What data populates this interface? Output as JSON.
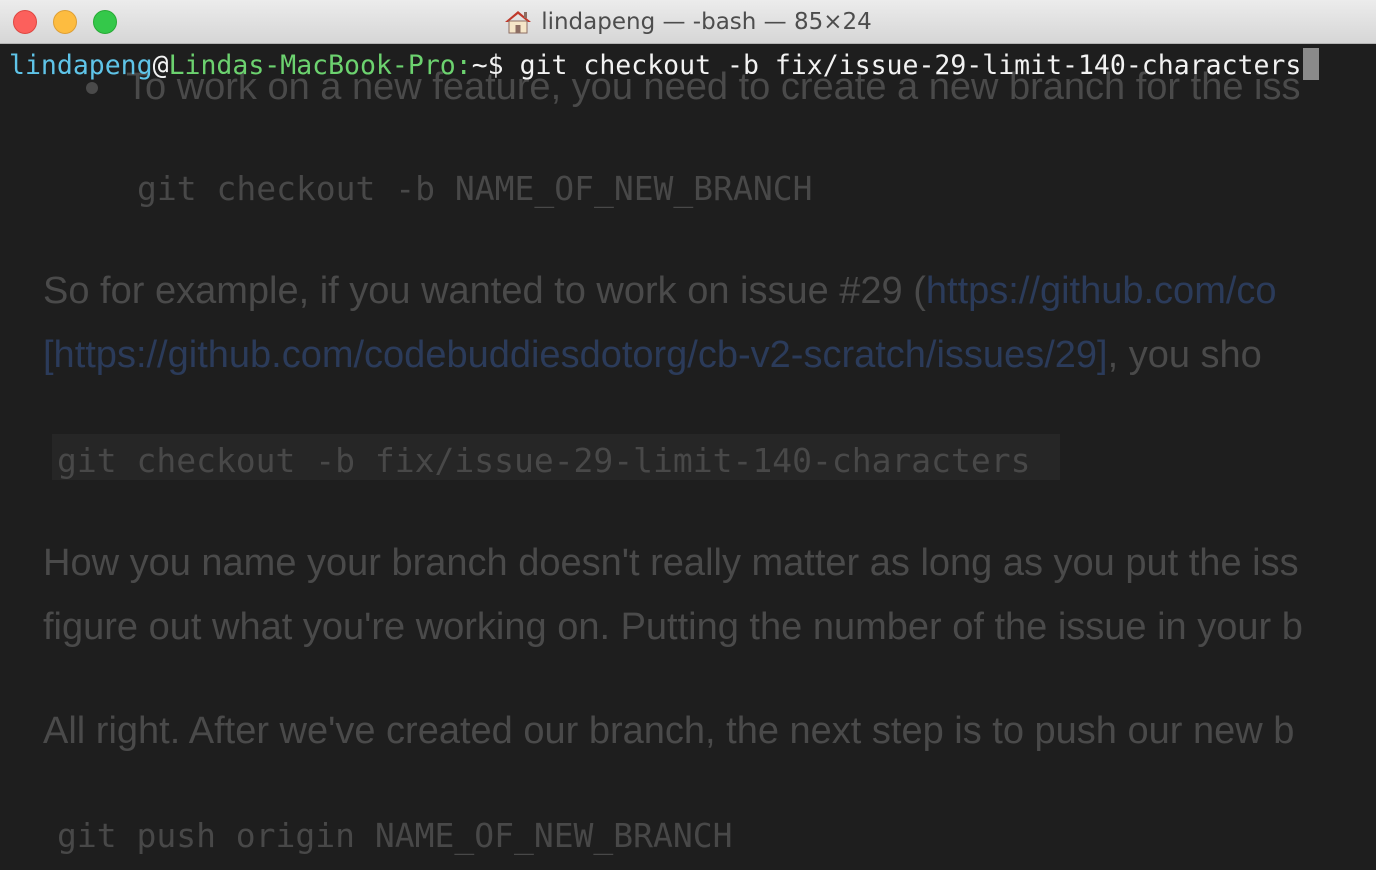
{
  "window": {
    "title": "lindapeng — -bash — 85×24"
  },
  "prompt": {
    "user": "lindapeng",
    "at": "@",
    "host": "Lindas-MacBook-Pro:",
    "path": "~$",
    "command": " git checkout -b fix/issue-29-limit-140-characters"
  },
  "background_doc": {
    "bullet_text": "To work on a new feature, you need to create a new branch for the iss",
    "code_1": "git checkout -b NAME_OF_NEW_BRANCH",
    "para_1_prefix": "So for example, if you wanted to work on issue #29 (",
    "para_1_link": "https://github.com/co",
    "para_2_link": "[https://github.com/codebuddiesdotorg/cb-v2-scratch/issues/29]",
    "para_2_suffix": ", you sho",
    "code_2": "git checkout -b fix/issue-29-limit-140-characters",
    "para_3_line_1": "How you name your branch doesn't really matter as long as you put the iss",
    "para_3_line_2": "figure out what you're working on. Putting the number of the issue in your b",
    "para_4": "All right. After we've created our branch, the next step is to push our new b",
    "code_3": "git push origin NAME_OF_NEW_BRANCH"
  },
  "colors": {
    "titlebar": "#e3e3e3",
    "terminal_bg": "#1e1e1e",
    "prompt_user": "#5fc4e8",
    "prompt_host": "#6cd26f",
    "close": "#fc605c",
    "minimize": "#fdbc40",
    "zoom": "#34c84a"
  }
}
